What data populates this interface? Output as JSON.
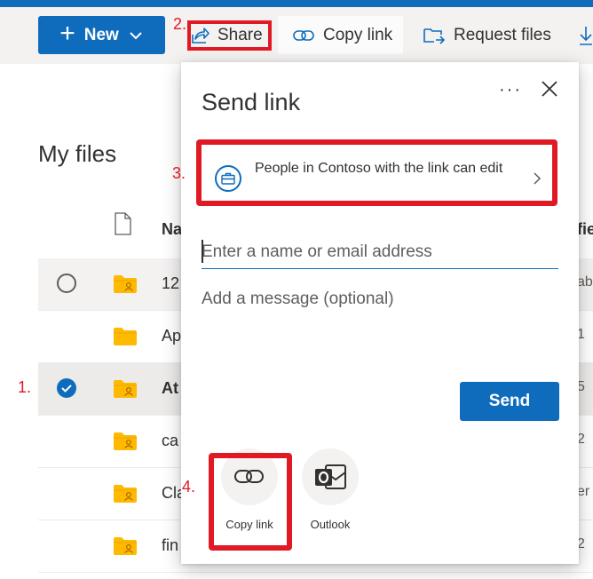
{
  "commandbar": {
    "new_label": "New",
    "share_label": "Share",
    "copy_link_label": "Copy link",
    "request_files_label": "Request files"
  },
  "annotations": {
    "step1": "1.",
    "step2": "2.",
    "step3": "3.",
    "step4": "4."
  },
  "files": {
    "title": "My files",
    "name_header": "Na",
    "modified_header": "fie",
    "rows": [
      {
        "name": "12",
        "modified": "abe",
        "shared": true,
        "state": "hover"
      },
      {
        "name": "Ap",
        "modified": "1",
        "shared": false,
        "state": "normal"
      },
      {
        "name": "At",
        "modified": "5",
        "shared": true,
        "state": "selected"
      },
      {
        "name": "ca",
        "modified": "2",
        "shared": true,
        "state": "normal"
      },
      {
        "name": "Cla",
        "modified": "er",
        "shared": true,
        "state": "normal"
      },
      {
        "name": "fin",
        "modified": "2",
        "shared": true,
        "state": "normal"
      }
    ]
  },
  "dialog": {
    "title": "Send link",
    "more_label": "···",
    "permission_text": "People in Contoso with the link can edit",
    "email_placeholder": "Enter a name or email address",
    "message_placeholder": "Add a message (optional)",
    "send_label": "Send",
    "apps": [
      {
        "label": "Copy link",
        "icon": "link-icon"
      },
      {
        "label": "Outlook",
        "icon": "outlook-icon"
      }
    ]
  },
  "colors": {
    "accent": "#0f6cbd",
    "annotation": "#e01a24",
    "folder": "#ffb900"
  }
}
